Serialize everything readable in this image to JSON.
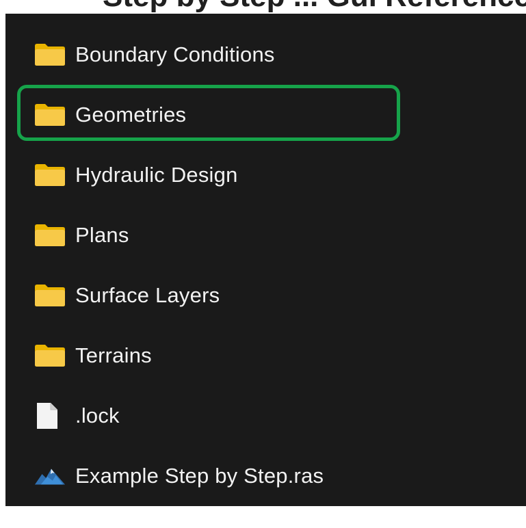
{
  "top": {
    "partial_text": "Step by Step ... Gui Reference"
  },
  "highlight": {
    "color": "#16a34a",
    "item": "Geometries"
  },
  "items": [
    {
      "label": "Boundary Conditions",
      "icon": "folder-icon",
      "type": "folder"
    },
    {
      "label": "Geometries",
      "icon": "folder-icon",
      "type": "folder"
    },
    {
      "label": "Hydraulic Design",
      "icon": "folder-icon",
      "type": "folder"
    },
    {
      "label": "Plans",
      "icon": "folder-icon",
      "type": "folder"
    },
    {
      "label": "Surface Layers",
      "icon": "folder-icon",
      "type": "folder"
    },
    {
      "label": "Terrains",
      "icon": "folder-icon",
      "type": "folder"
    },
    {
      "label": ".lock",
      "icon": "file-icon",
      "type": "file"
    },
    {
      "label": "Example Step by Step.ras",
      "icon": "hec-ras-project-icon",
      "type": "project"
    }
  ],
  "colors": {
    "background": "#1a1a1a",
    "text": "#f2f2f2",
    "folder": "#f5c518",
    "file": "#f3f3f3",
    "ras_icon": "#2f6fb0"
  }
}
